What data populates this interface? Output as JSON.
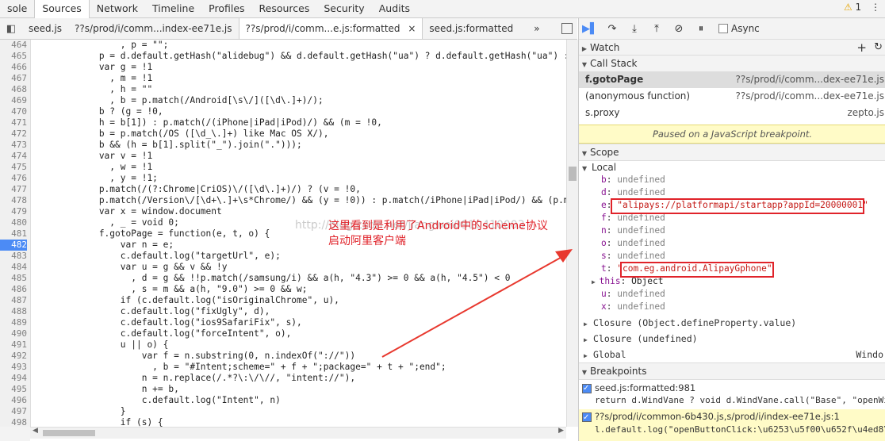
{
  "top_tabs": [
    "sole",
    "Sources",
    "Network",
    "Timeline",
    "Profiles",
    "Resources",
    "Security",
    "Audits"
  ],
  "active_top_tab": "Sources",
  "warning_count": "1",
  "file_tabs": [
    {
      "label": "seed.js",
      "active": false
    },
    {
      "label": "??s/prod/i/comm...index-ee71e.js",
      "active": false
    },
    {
      "label": "??s/prod/i/comm...e.js:formatted",
      "active": true
    },
    {
      "label": "seed.js:formatted",
      "active": false
    }
  ],
  "tab_close_glyph": "×",
  "more_tabs_glyph": "»",
  "code": {
    "breakpoint_line": 482,
    "lines": [
      {
        "n": 464,
        "t": "                , p = \"\";"
      },
      {
        "n": 465,
        "t": "            p = d.default.getHash(\"alidebug\") && d.default.getHash(\"ua\") ? d.default.getHash(\"ua\") : w"
      },
      {
        "n": 466,
        "t": "            var g = !1"
      },
      {
        "n": 467,
        "t": "              , m = !1"
      },
      {
        "n": 468,
        "t": "              , h = \"\""
      },
      {
        "n": 469,
        "t": "              , b = p.match(/Android[\\s\\/]([\\d\\.]+)/);"
      },
      {
        "n": 470,
        "t": "            b ? (g = !0,"
      },
      {
        "n": 471,
        "t": "            h = b[1]) : p.match(/(iPhone|iPad|iPod)/) && (m = !0,"
      },
      {
        "n": 472,
        "t": "            b = p.match(/OS ([\\d_\\.]+) like Mac OS X/),"
      },
      {
        "n": 473,
        "t": "            b && (h = b[1].split(\"_\").join(\".\")));"
      },
      {
        "n": 474,
        "t": "            var v = !1"
      },
      {
        "n": 475,
        "t": "              , w = !1"
      },
      {
        "n": 476,
        "t": "              , y = !1;"
      },
      {
        "n": 477,
        "t": "            p.match(/(?:Chrome|CriOS)\\/([\\d\\.]+)/) ? (v = !0,"
      },
      {
        "n": 478,
        "t": "            p.match(/Version\\/[\\d+\\.]+\\s*Chrome/) && (y = !0)) : p.match(/iPhone|iPad|iPod/) && (p.mat"
      },
      {
        "n": 479,
        "t": "            var x = window.document"
      },
      {
        "n": 480,
        "t": "              , _ = void 0;"
      },
      {
        "n": 481,
        "t": "            f.gotoPage = function(e, t, o) {"
      },
      {
        "n": 482,
        "t": "                var n = e;"
      },
      {
        "n": 483,
        "t": "                c.default.log(\"targetUrl\", e);"
      },
      {
        "n": 484,
        "t": "                var u = g && v && !y"
      },
      {
        "n": 485,
        "t": "                  , d = g && !!p.match(/samsung/i) && a(h, \"4.3\") >= 0 && a(h, \"4.5\") < 0"
      },
      {
        "n": 486,
        "t": "                  , s = m && a(h, \"9.0\") >= 0 && w;"
      },
      {
        "n": 487,
        "t": "                if (c.default.log(\"isOriginalChrome\", u),"
      },
      {
        "n": 488,
        "t": "                c.default.log(\"fixUgly\", d),"
      },
      {
        "n": 489,
        "t": "                c.default.log(\"ios9SafariFix\", s),"
      },
      {
        "n": 490,
        "t": "                c.default.log(\"forceIntent\", o),"
      },
      {
        "n": 491,
        "t": "                u || o) {"
      },
      {
        "n": 492,
        "t": "                    var f = n.substring(0, n.indexOf(\"://\"))"
      },
      {
        "n": 493,
        "t": "                      , b = \"#Intent;scheme=\" + f + \";package=\" + t + \";end\";"
      },
      {
        "n": 494,
        "t": "                    n = n.replace(/.*?\\:\\/\\//, \"intent://\"),"
      },
      {
        "n": 495,
        "t": "                    n += b,"
      },
      {
        "n": 496,
        "t": "                    c.default.log(\"Intent\", n)"
      },
      {
        "n": 497,
        "t": "                }"
      },
      {
        "n": 498,
        "t": "                if (s) {"
      },
      {
        "n": 499,
        "t": ""
      }
    ]
  },
  "watermark_text": "http://blog.csdn.net/jiangwei0910410003",
  "annotation": {
    "line1": "这里看到是利用了Android中的scheme协议",
    "line2": "启动阿里客户端",
    "color": "#e0232a"
  },
  "debugger_toolbar": {
    "async_label": "Async"
  },
  "watch": {
    "label": "Watch",
    "add_glyph": "+",
    "refresh_glyph": "↻"
  },
  "call_stack": {
    "label": "Call Stack",
    "frames": [
      {
        "fn": "f.gotoPage",
        "loc": "??s/prod/i/comm...dex-ee71e.js",
        "selected": true
      },
      {
        "fn": "(anonymous function)",
        "loc": "??s/prod/i/comm...dex-ee71e.js",
        "selected": false
      },
      {
        "fn": "s.proxy",
        "loc": "zepto.js",
        "selected": false
      }
    ]
  },
  "paused_message": "Paused on a JavaScript breakpoint.",
  "scope": {
    "label": "Scope",
    "local_label": "Local",
    "vars": [
      {
        "name": "b",
        "value": "undefined",
        "kind": "und"
      },
      {
        "name": "d",
        "value": "undefined",
        "kind": "und"
      },
      {
        "name": "e",
        "value": "\"alipays://platformapi/startapp?appId=20000001\"",
        "kind": "str"
      },
      {
        "name": "f",
        "value": "undefined",
        "kind": "und"
      },
      {
        "name": "n",
        "value": "undefined",
        "kind": "und"
      },
      {
        "name": "o",
        "value": "undefined",
        "kind": "und"
      },
      {
        "name": "s",
        "value": "undefined",
        "kind": "und"
      },
      {
        "name": "t",
        "value": "\"com.eg.android.AlipayGphone\"",
        "kind": "str"
      },
      {
        "name": "this",
        "value": "Object",
        "kind": "obj"
      },
      {
        "name": "u",
        "value": "undefined",
        "kind": "und"
      },
      {
        "name": "x",
        "value": "undefined",
        "kind": "und"
      }
    ],
    "closures": [
      {
        "label": "Closure (Object.defineProperty.value)"
      },
      {
        "label": "Closure (undefined)"
      },
      {
        "label": "Global",
        "right": "Windo"
      }
    ]
  },
  "breakpoints": {
    "label": "Breakpoints",
    "items": [
      {
        "file": "seed.js:formatted:981",
        "code": "return d.WindVane ? void d.WindVane.call(\"Base\", \"openWi",
        "active": false
      },
      {
        "file": "??s/prod/i/common-6b430.js,s/prod/i/index-ee71e.js:1",
        "code": "l.default.log(\"openButtonClick:\\u6253\\u5f00\\u652f\\u4ed8\\u5",
        "active": true
      }
    ]
  }
}
